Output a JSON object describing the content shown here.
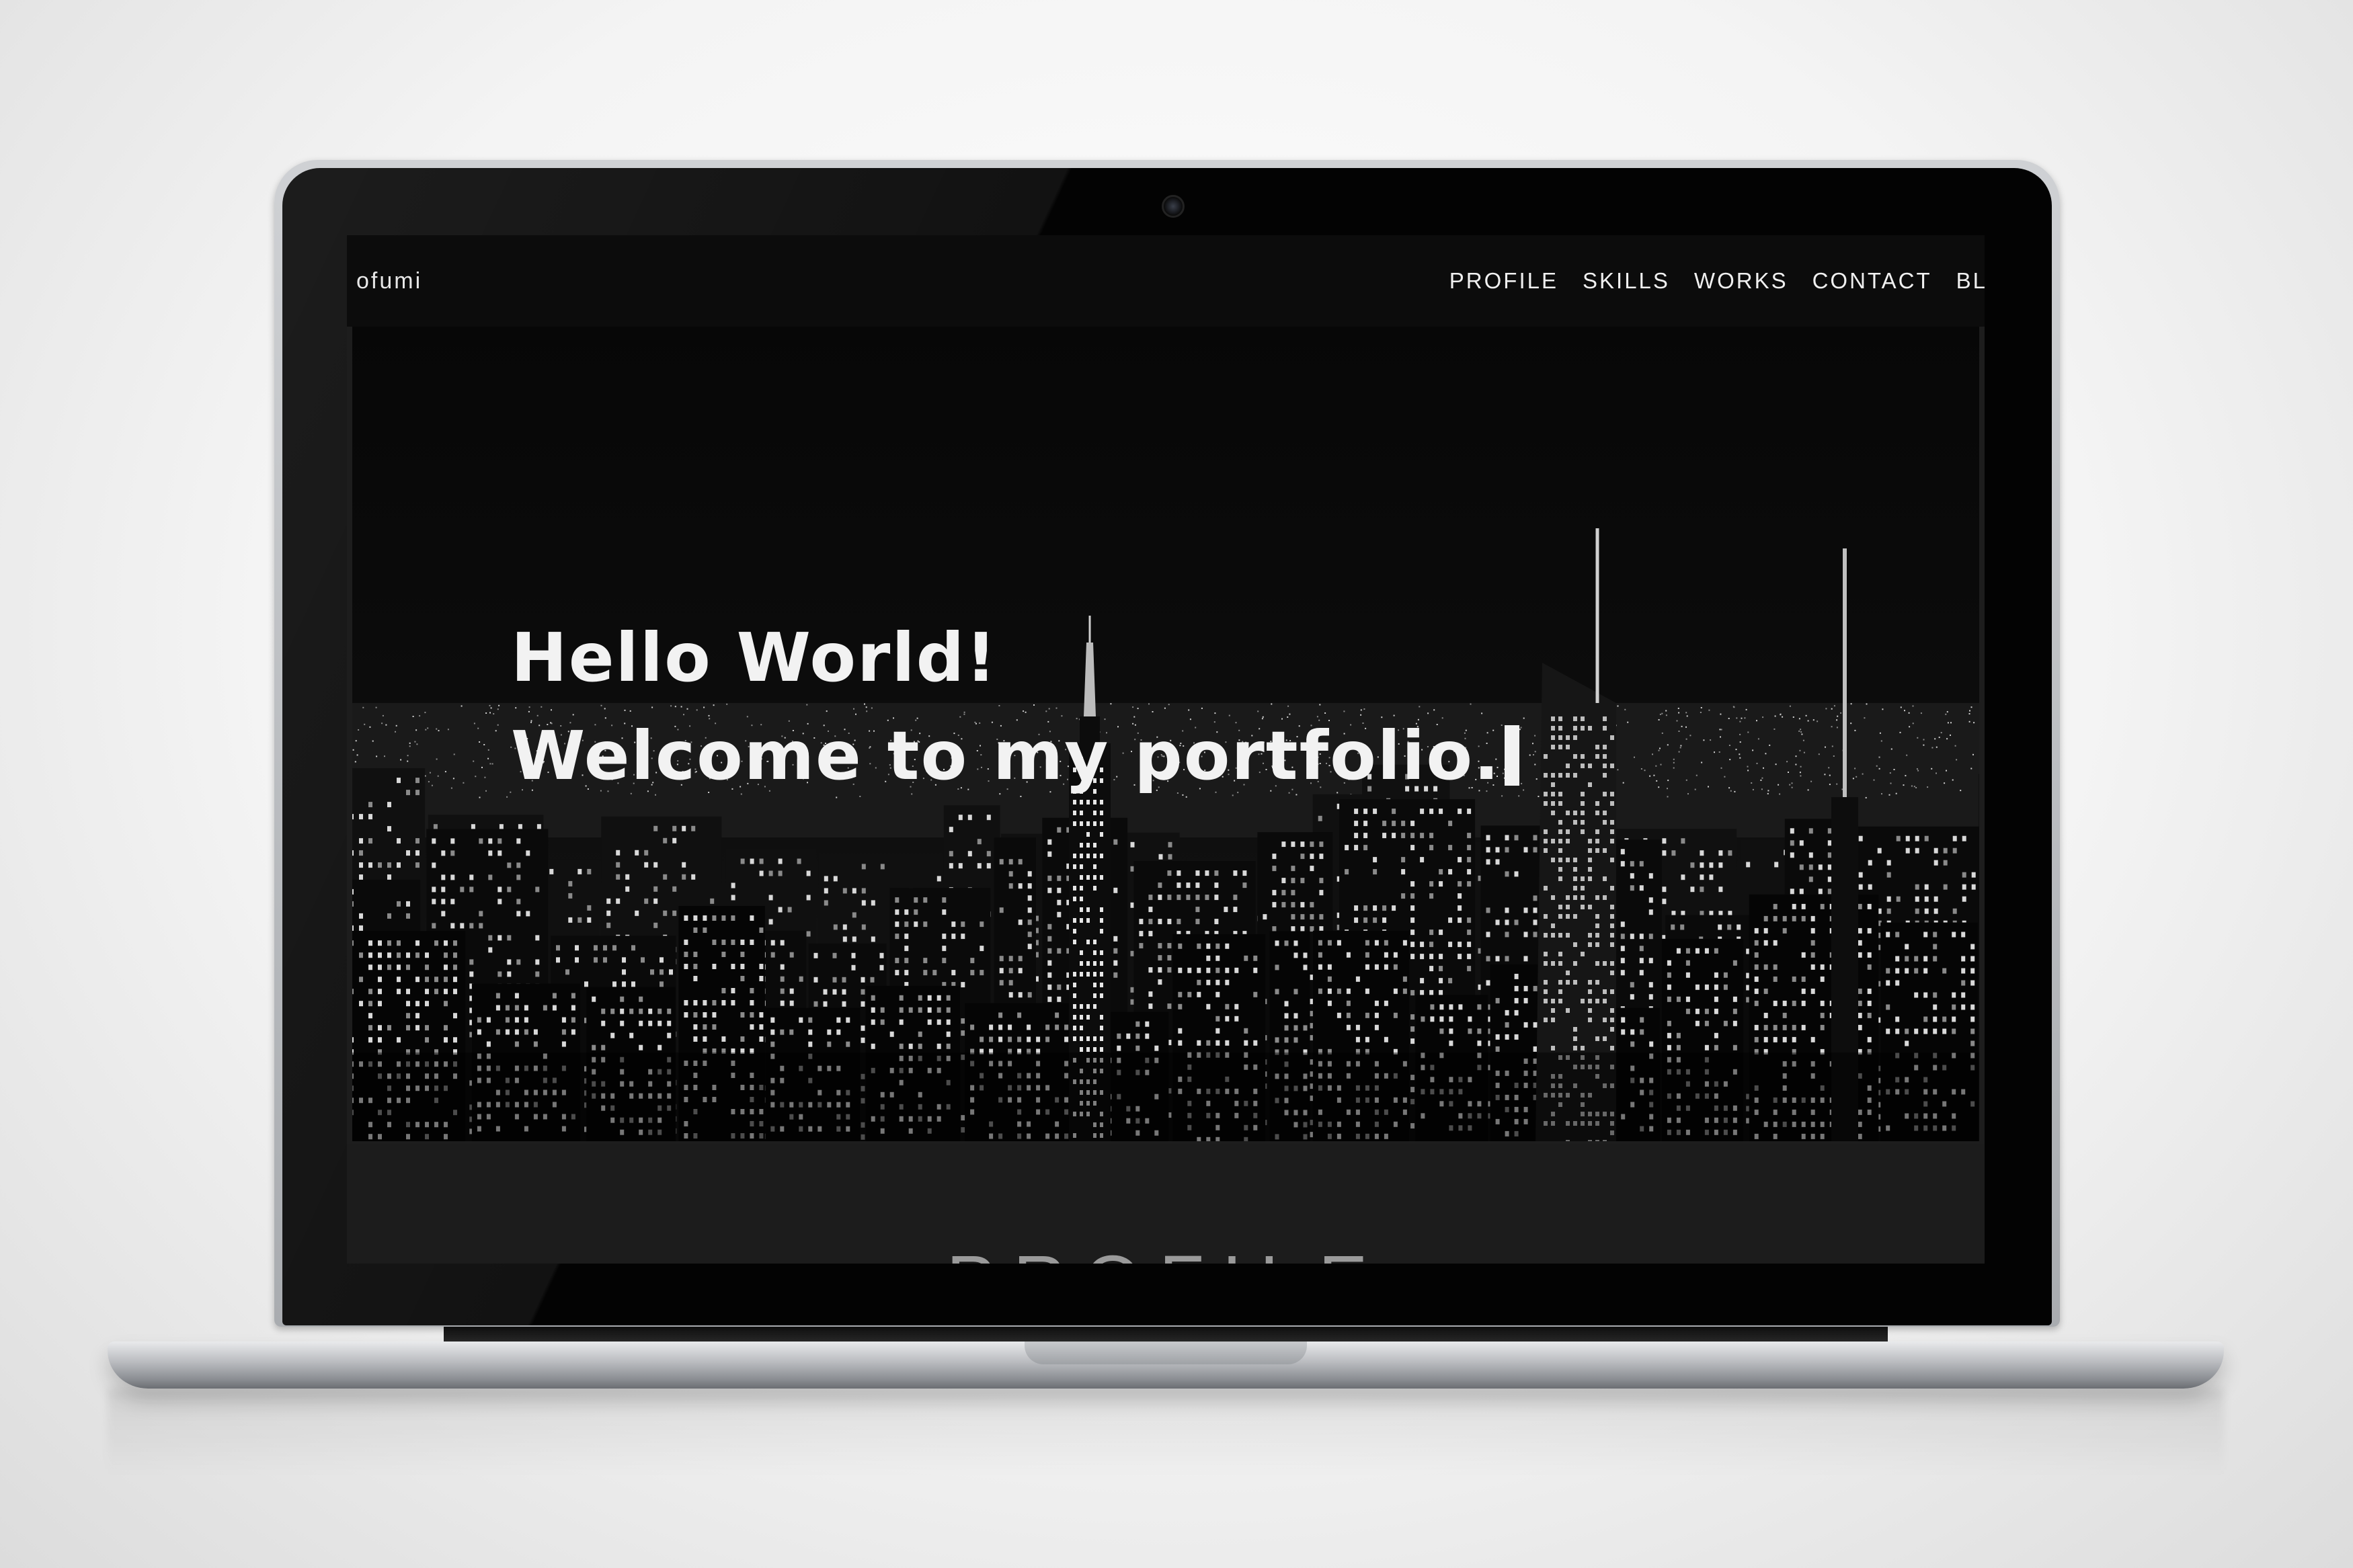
{
  "header": {
    "brand": "ofumi",
    "nav": [
      "PROFILE",
      "SKILLS",
      "WORKS",
      "CONTACT",
      "BL("
    ]
  },
  "hero": {
    "line1": "Hello World!",
    "line2": "Welcome to my portfolio."
  },
  "sections": {
    "profile_heading": "PROFILE"
  },
  "colors": {
    "header_bg": "#0c0c0c",
    "text": "#f2f2f2",
    "page_bg": "#1c1c1c"
  }
}
